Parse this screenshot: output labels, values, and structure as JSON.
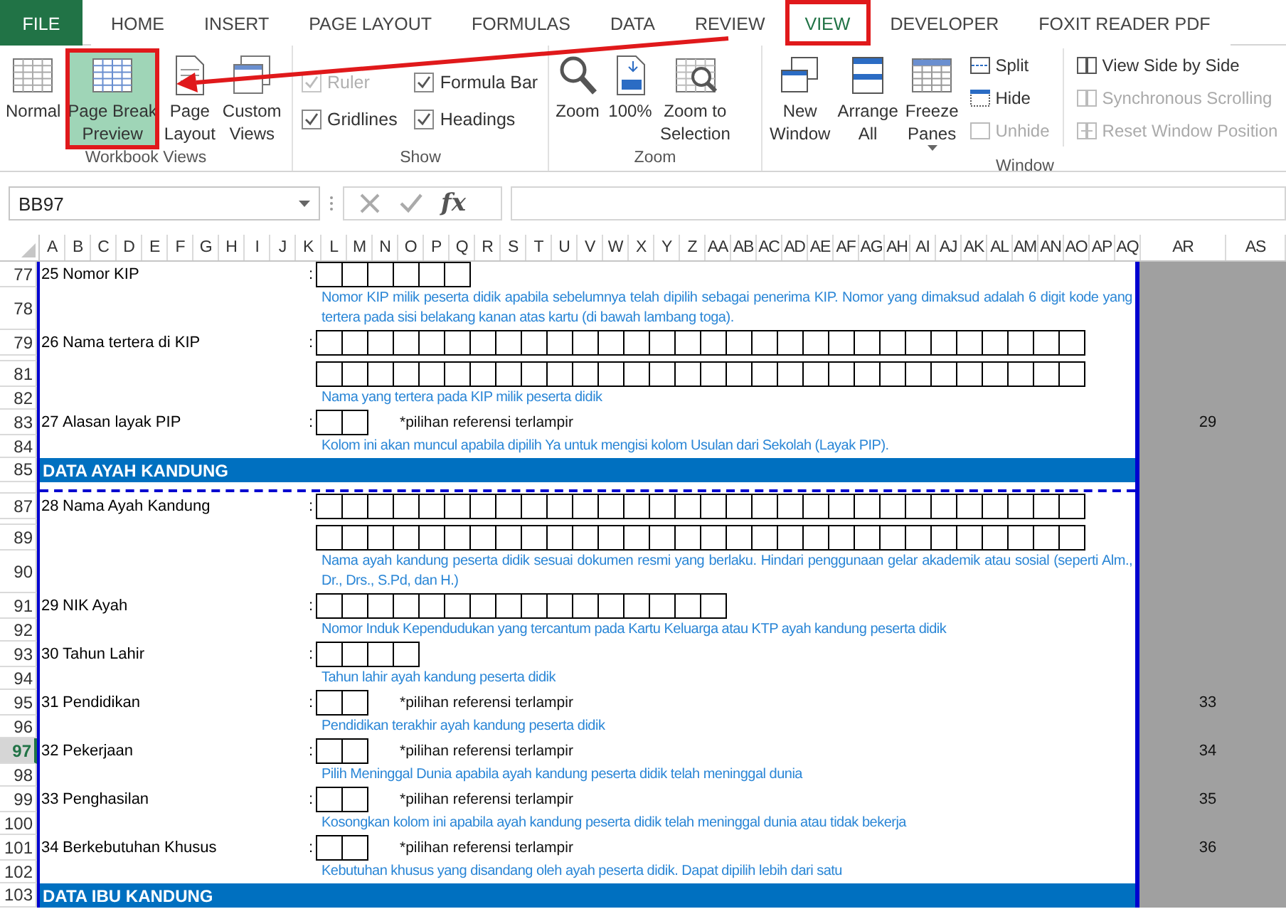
{
  "tabs": [
    {
      "label": "FILE",
      "kind": "file",
      "selected": false,
      "highlighted": false
    },
    {
      "label": "HOME",
      "kind": "tab",
      "selected": false,
      "highlighted": false
    },
    {
      "label": "INSERT",
      "kind": "tab",
      "selected": false,
      "highlighted": false
    },
    {
      "label": "PAGE LAYOUT",
      "kind": "tab",
      "selected": false,
      "highlighted": false
    },
    {
      "label": "FORMULAS",
      "kind": "tab",
      "selected": false,
      "highlighted": false
    },
    {
      "label": "DATA",
      "kind": "tab",
      "selected": false,
      "highlighted": false
    },
    {
      "label": "REVIEW",
      "kind": "tab",
      "selected": false,
      "highlighted": false
    },
    {
      "label": "VIEW",
      "kind": "tab",
      "selected": true,
      "highlighted": true
    },
    {
      "label": "DEVELOPER",
      "kind": "tab",
      "selected": false,
      "highlighted": false
    },
    {
      "label": "FOXIT READER PDF",
      "kind": "tab",
      "selected": false,
      "highlighted": false
    }
  ],
  "ribbon": {
    "groups": [
      {
        "label": "Workbook Views",
        "items": [
          {
            "kind": "large",
            "label": "Normal",
            "selected": false,
            "highlighted": false
          },
          {
            "kind": "large",
            "label": "Page Break\nPreview",
            "selected": true,
            "highlighted": true
          },
          {
            "kind": "large",
            "label": "Page\nLayout",
            "selected": false,
            "highlighted": false
          },
          {
            "kind": "large",
            "label": "Custom\nViews",
            "selected": false,
            "highlighted": false
          }
        ]
      },
      {
        "label": "Show",
        "items": [
          {
            "kind": "check",
            "label": "Ruler",
            "checked": true,
            "disabled": true
          },
          {
            "kind": "check",
            "label": "Formula Bar",
            "checked": true,
            "disabled": false
          },
          {
            "kind": "check",
            "label": "Gridlines",
            "checked": true,
            "disabled": false
          },
          {
            "kind": "check",
            "label": "Headings",
            "checked": true,
            "disabled": false
          }
        ]
      },
      {
        "label": "Zoom",
        "items": [
          {
            "kind": "large",
            "label": "Zoom"
          },
          {
            "kind": "large",
            "label": "100%"
          },
          {
            "kind": "large",
            "label": "Zoom to\nSelection"
          }
        ]
      },
      {
        "label": "Window",
        "items": [
          {
            "kind": "large",
            "label": "New\nWindow"
          },
          {
            "kind": "large",
            "label": "Arrange\nAll"
          },
          {
            "kind": "large",
            "label": "Freeze\nPanes",
            "dropdown": true
          },
          {
            "kind": "small",
            "label": "Split",
            "disabled": false
          },
          {
            "kind": "small",
            "label": "Hide",
            "disabled": false
          },
          {
            "kind": "small",
            "label": "Unhide",
            "disabled": true
          },
          {
            "kind": "small",
            "label": "View Side by Side",
            "disabled": false
          },
          {
            "kind": "small",
            "label": "Synchronous Scrolling",
            "disabled": true
          },
          {
            "kind": "small",
            "label": "Reset Window Position",
            "disabled": true
          }
        ]
      }
    ]
  },
  "formula_bar": {
    "name_box": "BB97",
    "function_label": "fx"
  },
  "columns": [
    {
      "label": "A",
      "kind": "page"
    },
    {
      "label": "B",
      "kind": "page"
    },
    {
      "label": "C",
      "kind": "page"
    },
    {
      "label": "D",
      "kind": "page"
    },
    {
      "label": "E",
      "kind": "page"
    },
    {
      "label": "F",
      "kind": "page"
    },
    {
      "label": "G",
      "kind": "page"
    },
    {
      "label": "H",
      "kind": "page"
    },
    {
      "label": "I",
      "kind": "page"
    },
    {
      "label": "J",
      "kind": "page"
    },
    {
      "label": "K",
      "kind": "page"
    },
    {
      "label": "L",
      "kind": "page"
    },
    {
      "label": "M",
      "kind": "page"
    },
    {
      "label": "N",
      "kind": "page"
    },
    {
      "label": "O",
      "kind": "page"
    },
    {
      "label": "P",
      "kind": "page"
    },
    {
      "label": "Q",
      "kind": "page"
    },
    {
      "label": "R",
      "kind": "page"
    },
    {
      "label": "S",
      "kind": "page"
    },
    {
      "label": "T",
      "kind": "page"
    },
    {
      "label": "U",
      "kind": "page"
    },
    {
      "label": "V",
      "kind": "page"
    },
    {
      "label": "W",
      "kind": "page"
    },
    {
      "label": "X",
      "kind": "page"
    },
    {
      "label": "Y",
      "kind": "page"
    },
    {
      "label": "Z",
      "kind": "page"
    },
    {
      "label": "AA",
      "kind": "page"
    },
    {
      "label": "AB",
      "kind": "page"
    },
    {
      "label": "AC",
      "kind": "page"
    },
    {
      "label": "AD",
      "kind": "page"
    },
    {
      "label": "AE",
      "kind": "page"
    },
    {
      "label": "AF",
      "kind": "page"
    },
    {
      "label": "AG",
      "kind": "page"
    },
    {
      "label": "AH",
      "kind": "page"
    },
    {
      "label": "AI",
      "kind": "page"
    },
    {
      "label": "AJ",
      "kind": "page"
    },
    {
      "label": "AK",
      "kind": "page"
    },
    {
      "label": "AL",
      "kind": "page"
    },
    {
      "label": "AM",
      "kind": "page"
    },
    {
      "label": "AN",
      "kind": "page"
    },
    {
      "label": "AO",
      "kind": "page"
    },
    {
      "label": "AP",
      "kind": "page"
    },
    {
      "label": "AQ",
      "kind": "page"
    },
    {
      "label": "AR",
      "kind": "outside"
    },
    {
      "label": "AS",
      "kind": "outside"
    }
  ],
  "rows": [
    {
      "kind": "field",
      "number": "77",
      "selected": false,
      "item": "25",
      "label": "Nomor KIP",
      "colon": ":",
      "input": {
        "kind": "kip"
      }
    },
    {
      "kind": "note",
      "number": "78",
      "selected": false,
      "text": "Nomor KIP milik peserta didik apabila sebelumnya telah dipilih sebagai penerima KIP. Nomor yang dimaksud adalah 6 digit kode yang tertera pada sisi belakang kanan atas kartu (di bawah lambang toga)."
    },
    {
      "kind": "field",
      "number": "79",
      "selected": false,
      "item": "26",
      "label": "Nama tertera di KIP",
      "colon": ":",
      "input": {
        "kind": "name"
      }
    },
    {
      "kind": "spacer"
    },
    {
      "kind": "field",
      "number": "81",
      "selected": false,
      "input": {
        "kind": "name"
      }
    },
    {
      "kind": "note",
      "number": "82",
      "selected": false,
      "text": "Nama yang tertera pada KIP milik peserta didik"
    },
    {
      "kind": "field",
      "number": "83",
      "selected": false,
      "item": "27",
      "label": "Alasan layak PIP",
      "colon": ":",
      "input": {
        "kind": "code"
      },
      "hint": "*pilihan referensi terlampir",
      "ar": "29"
    },
    {
      "kind": "note",
      "number": "84",
      "selected": false,
      "text": "Kolom ini akan muncul apabila dipilih Ya untuk mengisi kolom Usulan dari Sekolah (Layak PIP)."
    },
    {
      "kind": "header",
      "number": "85",
      "selected": false,
      "text": "DATA AYAH KANDUNG"
    },
    {
      "kind": "break"
    },
    {
      "kind": "field",
      "number": "87",
      "selected": false,
      "item": "28",
      "label": "Nama Ayah Kandung",
      "colon": ":",
      "input": {
        "kind": "name"
      }
    },
    {
      "kind": "spacer"
    },
    {
      "kind": "field",
      "number": "89",
      "selected": false,
      "input": {
        "kind": "name"
      }
    },
    {
      "kind": "note",
      "number": "90",
      "selected": false,
      "text": "Nama ayah kandung peserta didik sesuai dokumen resmi yang berlaku. Hindari penggunaan gelar akademik atau sosial (seperti Alm., Dr., Drs., S.Pd, dan H.)"
    },
    {
      "kind": "field",
      "number": "91",
      "selected": false,
      "item": "29",
      "label": "NIK Ayah",
      "colon": ":",
      "input": {
        "kind": "nik"
      }
    },
    {
      "kind": "note",
      "number": "92",
      "selected": false,
      "text": "Nomor Induk Kependudukan yang tercantum pada Kartu Keluarga atau KTP ayah kandung peserta didik"
    },
    {
      "kind": "field",
      "number": "93",
      "selected": false,
      "item": "30",
      "label": "Tahun Lahir",
      "colon": ":",
      "input": {
        "kind": "year"
      }
    },
    {
      "kind": "note",
      "number": "94",
      "selected": false,
      "text": "Tahun lahir ayah kandung peserta didik"
    },
    {
      "kind": "field",
      "number": "95",
      "selected": false,
      "item": "31",
      "label": "Pendidikan",
      "colon": ":",
      "input": {
        "kind": "code"
      },
      "hint": "*pilihan referensi terlampir",
      "ar": "33"
    },
    {
      "kind": "note",
      "number": "96",
      "selected": false,
      "text": "Pendidikan terakhir ayah kandung peserta didik"
    },
    {
      "kind": "field",
      "number": "97",
      "selected": true,
      "item": "32",
      "label": "Pekerjaan",
      "colon": ":",
      "input": {
        "kind": "code"
      },
      "hint": "*pilihan referensi terlampir",
      "ar": "34"
    },
    {
      "kind": "note",
      "number": "98",
      "selected": false,
      "text": "Pilih Meninggal Dunia apabila ayah kandung peserta didik telah meninggal dunia"
    },
    {
      "kind": "field",
      "number": "99",
      "selected": false,
      "item": "33",
      "label": "Penghasilan",
      "colon": ":",
      "input": {
        "kind": "code"
      },
      "hint": "*pilihan referensi terlampir",
      "ar": "35"
    },
    {
      "kind": "note",
      "number": "100",
      "selected": false,
      "text": "Kosongkan kolom ini apabila ayah kandung peserta didik telah meninggal dunia atau tidak bekerja"
    },
    {
      "kind": "field",
      "number": "101",
      "selected": false,
      "item": "34",
      "label": "Berkebutuhan Khusus",
      "colon": ":",
      "input": {
        "kind": "code"
      },
      "hint": "*pilihan referensi terlampir",
      "ar": "36"
    },
    {
      "kind": "note",
      "number": "102",
      "selected": false,
      "text": "Kebutuhan khusus yang disandang oleh ayah peserta didik. Dapat dipilih lebih dari satu"
    },
    {
      "kind": "header",
      "number": "103",
      "selected": false,
      "text": "DATA IBU KANDUNG"
    }
  ],
  "annotation_arrow": true
}
